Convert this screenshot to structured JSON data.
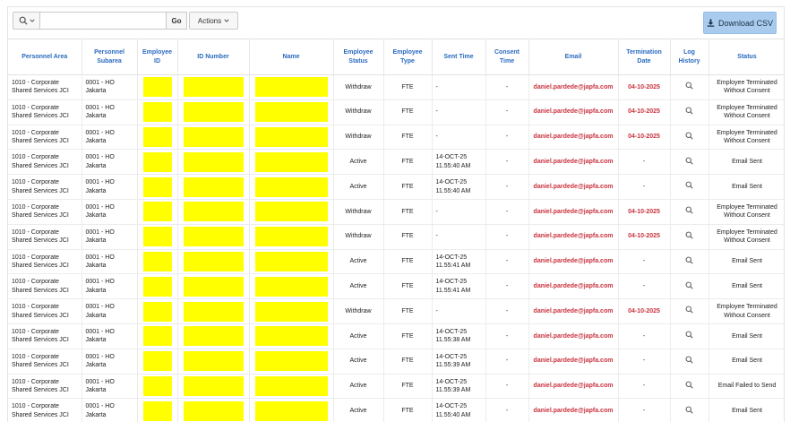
{
  "toolbar": {
    "search_value": "",
    "go_label": "Go",
    "actions_label": "Actions",
    "csv_label": "Download CSV"
  },
  "columns": [
    "Personnel Area",
    "Personnel Subarea",
    "Employee ID",
    "ID Number",
    "Name",
    "Employee Status",
    "Employee Type",
    "Sent Time",
    "Consent Time",
    "Email",
    "Termination Date",
    "Log History",
    "Status"
  ],
  "rows": [
    {
      "area": "1010 - Corporate Shared Services JCI",
      "subarea": "0001 - HO Jakarta",
      "status": "Withdraw",
      "type": "FTE",
      "sent": "-",
      "consent": "-",
      "email": "daniel.pardede@japfa.com",
      "term": "04-10-2025",
      "final": "Employee Terminated Without Consent"
    },
    {
      "area": "1010 - Corporate Shared Services JCI",
      "subarea": "0001 - HO Jakarta",
      "status": "Withdraw",
      "type": "FTE",
      "sent": "-",
      "consent": "-",
      "email": "daniel.pardede@japfa.com",
      "term": "04-10-2025",
      "final": "Employee Terminated Without Consent"
    },
    {
      "area": "1010 - Corporate Shared Services JCI",
      "subarea": "0001 - HO Jakarta",
      "status": "Withdraw",
      "type": "FTE",
      "sent": "-",
      "consent": "-",
      "email": "daniel.pardede@japfa.com",
      "term": "04-10-2025",
      "final": "Employee Terminated Without Consent"
    },
    {
      "area": "1010 - Corporate Shared Services JCI",
      "subarea": "0001 - HO Jakarta",
      "status": "Active",
      "type": "FTE",
      "sent": "14-OCT-25 11.55:40 AM",
      "consent": "-",
      "email": "daniel.pardede@japfa.com",
      "term": "-",
      "final": "Email Sent"
    },
    {
      "area": "1010 - Corporate Shared Services JCI",
      "subarea": "0001 - HO Jakarta",
      "status": "Active",
      "type": "FTE",
      "sent": "14-OCT-25 11.55:40 AM",
      "consent": "-",
      "email": "daniel.pardede@japfa.com",
      "term": "-",
      "final": "Email Sent"
    },
    {
      "area": "1010 - Corporate Shared Services JCI",
      "subarea": "0001 - HO Jakarta",
      "status": "Withdraw",
      "type": "FTE",
      "sent": "-",
      "consent": "-",
      "email": "daniel.pardede@japfa.com",
      "term": "04-10-2025",
      "final": "Employee Terminated Without Consent"
    },
    {
      "area": "1010 - Corporate Shared Services JCI",
      "subarea": "0001 - HO Jakarta",
      "status": "Withdraw",
      "type": "FTE",
      "sent": "-",
      "consent": "-",
      "email": "daniel.pardede@japfa.com",
      "term": "04-10-2025",
      "final": "Employee Terminated Without Consent"
    },
    {
      "area": "1010 - Corporate Shared Services JCI",
      "subarea": "0001 - HO Jakarta",
      "status": "Active",
      "type": "FTE",
      "sent": "14-OCT-25 11.55:41 AM",
      "consent": "-",
      "email": "daniel.pardede@japfa.com",
      "term": "-",
      "final": "Email Sent"
    },
    {
      "area": "1010 - Corporate Shared Services JCI",
      "subarea": "0001 - HO Jakarta",
      "status": "Active",
      "type": "FTE",
      "sent": "14-OCT-25 11.55:41 AM",
      "consent": "-",
      "email": "daniel.pardede@japfa.com",
      "term": "-",
      "final": "Email Sent"
    },
    {
      "area": "1010 - Corporate Shared Services JCI",
      "subarea": "0001 - HO Jakarta",
      "status": "Withdraw",
      "type": "FTE",
      "sent": "-",
      "consent": "-",
      "email": "daniel.pardede@japfa.com",
      "term": "04-10-2025",
      "final": "Employee Terminated Without Consent"
    },
    {
      "area": "1010 - Corporate Shared Services JCI",
      "subarea": "0001 - HO Jakarta",
      "status": "Active",
      "type": "FTE",
      "sent": "14-OCT-25 11.55:38 AM",
      "consent": "-",
      "email": "daniel.pardede@japfa.com",
      "term": "-",
      "final": "Email Sent"
    },
    {
      "area": "1010 - Corporate Shared Services JCI",
      "subarea": "0001 - HO Jakarta",
      "status": "Active",
      "type": "FTE",
      "sent": "14-OCT-25 11.55:39 AM",
      "consent": "-",
      "email": "daniel.pardede@japfa.com",
      "term": "-",
      "final": "Email Sent"
    },
    {
      "area": "1010 - Corporate Shared Services JCI",
      "subarea": "0001 - HO Jakarta",
      "status": "Active",
      "type": "FTE",
      "sent": "14-OCT-25 11.55:39 AM",
      "consent": "-",
      "email": "daniel.pardede@japfa.com",
      "term": "-",
      "final": "Email Failed to Send"
    },
    {
      "area": "1010 - Corporate Shared Services JCI",
      "subarea": "0001 - HO Jakarta",
      "status": "Active",
      "type": "FTE",
      "sent": "14-OCT-25 11.55:40 AM",
      "consent": "-",
      "email": "daniel.pardede@japfa.com",
      "term": "-",
      "final": "Email Sent"
    }
  ],
  "colors": {
    "header_text": "#2a6ac0",
    "email_text": "#c8323e",
    "redaction": "#ffff00",
    "csv_button": "#a9ccee"
  },
  "icons": {
    "search": "magnifier-icon",
    "log": "magnifier-icon",
    "download": "download-icon",
    "caret": "chevron-down-icon"
  }
}
